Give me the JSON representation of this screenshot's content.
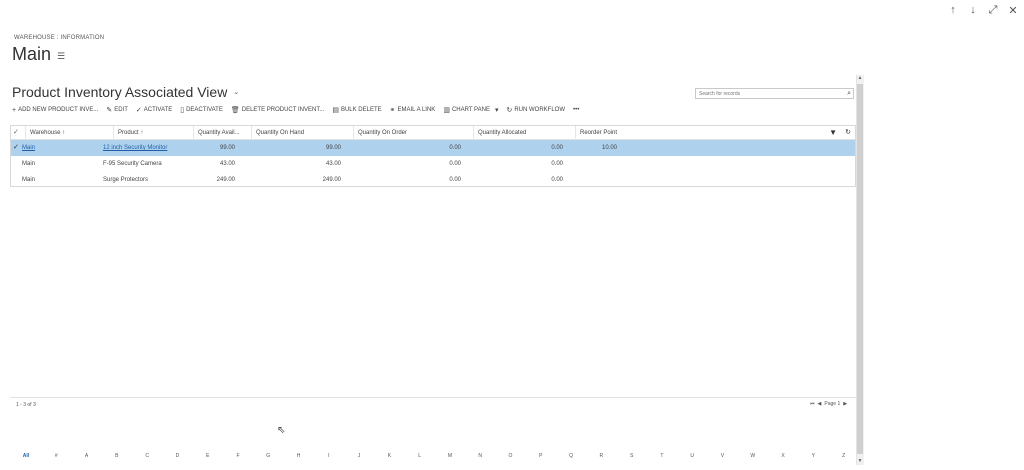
{
  "window_controls": {
    "up": "↑",
    "down": "↓",
    "expand": "⤢",
    "close": "✕"
  },
  "breadcrumb": "WAREHOUSE : INFORMATION",
  "record_title": "Main",
  "view_title": "Product Inventory Associated View",
  "search": {
    "placeholder": "Search for records"
  },
  "commands": [
    {
      "icon": "+",
      "label": "ADD NEW PRODUCT INVE..."
    },
    {
      "icon": "✎",
      "label": "EDIT"
    },
    {
      "icon": "✓",
      "label": "ACTIVATE"
    },
    {
      "icon": "▯",
      "label": "DEACTIVATE"
    },
    {
      "icon": "🗑",
      "label": "DELETE PRODUCT INVENT..."
    },
    {
      "icon": "▤",
      "label": "BULK DELETE"
    },
    {
      "icon": "⚭",
      "label": "EMAIL A LINK"
    },
    {
      "icon": "▥",
      "label": "CHART PANE"
    },
    {
      "icon": "↻",
      "label": "RUN WORKFLOW"
    },
    {
      "icon": "",
      "label": "•••"
    }
  ],
  "columns": [
    {
      "label": "Warehouse ↑"
    },
    {
      "label": "Product ↑"
    },
    {
      "label": "Quantity Avail..."
    },
    {
      "label": "Quantity On Hand"
    },
    {
      "label": "Quantity On Order"
    },
    {
      "label": "Quantity Allocated"
    },
    {
      "label": "Reorder Point"
    }
  ],
  "rows": [
    {
      "warehouse": "Main",
      "product": "12 inch Security Monitor",
      "available": "99.00",
      "on_hand": "99.00",
      "on_order": "0.00",
      "allocated": "0.00",
      "reorder": "10.00",
      "selected": true
    },
    {
      "warehouse": "Main",
      "product": "F-95 Security Camera",
      "available": "43.00",
      "on_hand": "43.00",
      "on_order": "0.00",
      "allocated": "0.00",
      "reorder": "",
      "selected": false
    },
    {
      "warehouse": "Main",
      "product": "Surge Protectors",
      "available": "249.00",
      "on_hand": "249.00",
      "on_order": "0.00",
      "allocated": "0.00",
      "reorder": "",
      "selected": false
    }
  ],
  "record_count": "1 - 3 of 3",
  "pager": {
    "first": "⏮",
    "prev": "◀",
    "label": "Page 1",
    "next": "▶"
  },
  "alphabet": [
    "All",
    "#",
    "A",
    "B",
    "C",
    "D",
    "E",
    "F",
    "G",
    "H",
    "I",
    "J",
    "K",
    "L",
    "M",
    "N",
    "O",
    "P",
    "Q",
    "R",
    "S",
    "T",
    "U",
    "V",
    "W",
    "X",
    "Y",
    "Z"
  ],
  "active_letter": "All",
  "colors": {
    "selected_row": "#aed1ee",
    "link": "#1f5fa8"
  }
}
